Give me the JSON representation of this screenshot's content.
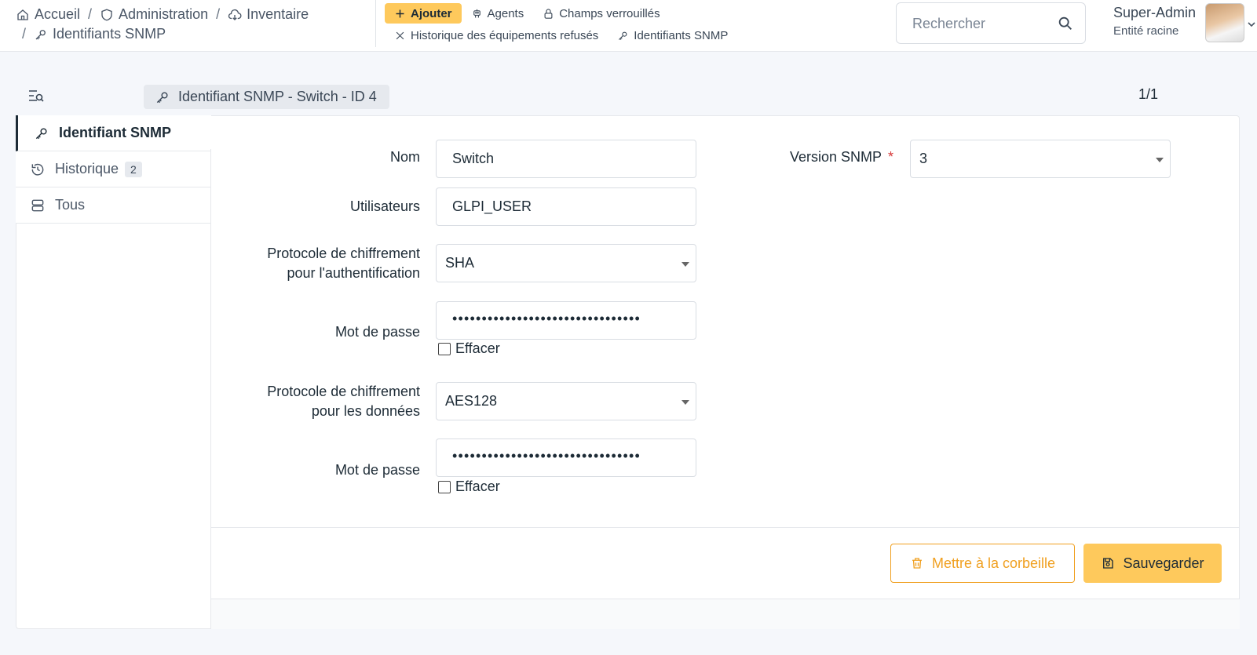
{
  "breadcrumb": {
    "home": "Accueil",
    "admin": "Administration",
    "inventory": "Inventaire",
    "current": "Identifiants SNMP"
  },
  "quicklinks": {
    "add": "Ajouter",
    "agents": "Agents",
    "locked_fields": "Champs verrouillés",
    "refused_history": "Historique des équipements refusés",
    "snmp_credentials": "Identifiants SNMP"
  },
  "search": {
    "placeholder": "Rechercher"
  },
  "user": {
    "name": "Super-Admin",
    "entity": "Entité racine"
  },
  "item": {
    "title": "Identifiant SNMP -  Switch - ID 4",
    "pager": "1/1"
  },
  "tabs": [
    {
      "label": "Identifiant SNMP"
    },
    {
      "label": "Historique",
      "count": "2"
    },
    {
      "label": "Tous"
    }
  ],
  "form": {
    "name_label": "Nom",
    "name_value": "Switch",
    "users_label": "Utilisateurs",
    "users_value": "GLPI_USER",
    "auth_proto_label_1": "Protocole de chiffrement",
    "auth_proto_label_2": "pour l'authentification",
    "auth_proto_value": "SHA",
    "auth_pw_label": "Mot de passe",
    "auth_pw_value": "••••••••••••••••••••••••••••••••",
    "clear_label": "Effacer",
    "priv_proto_label_1": "Protocole de chiffrement",
    "priv_proto_label_2": "pour les données",
    "priv_proto_value": "AES128",
    "priv_pw_label": "Mot de passe",
    "priv_pw_value": "••••••••••••••••••••••••••••••••",
    "version_label": "Version SNMP",
    "version_required": "*",
    "version_value": "3"
  },
  "actions": {
    "trash": "Mettre à la corbeille",
    "save": "Sauvegarder"
  },
  "colors": {
    "accent": "#fec95c",
    "warning": "#f0a020",
    "required": "#d63939"
  }
}
